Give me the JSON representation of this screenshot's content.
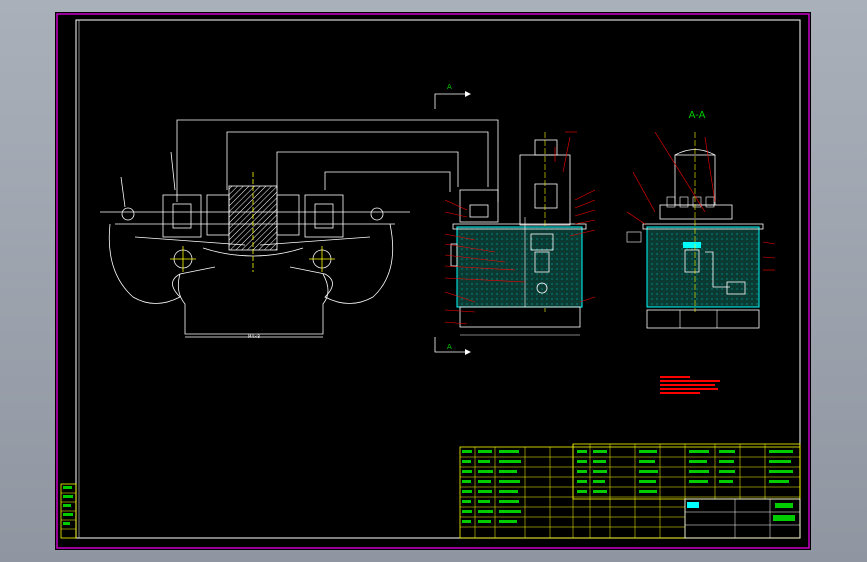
{
  "drawing": {
    "section_marker_top": "A",
    "section_marker_bottom": "A",
    "section_view_title": "A-A",
    "front_dimension": "M4×8"
  },
  "colors": {
    "background": "#000000",
    "frame": "#c800c8",
    "outline": "#ffffff",
    "annotation": "#ff0000",
    "section_fill": "#0a3a32",
    "table_lines": "#ffff00",
    "table_text": "#00cc00",
    "highlight": "#00ffff"
  },
  "icons": [
    "title-block-icon"
  ]
}
